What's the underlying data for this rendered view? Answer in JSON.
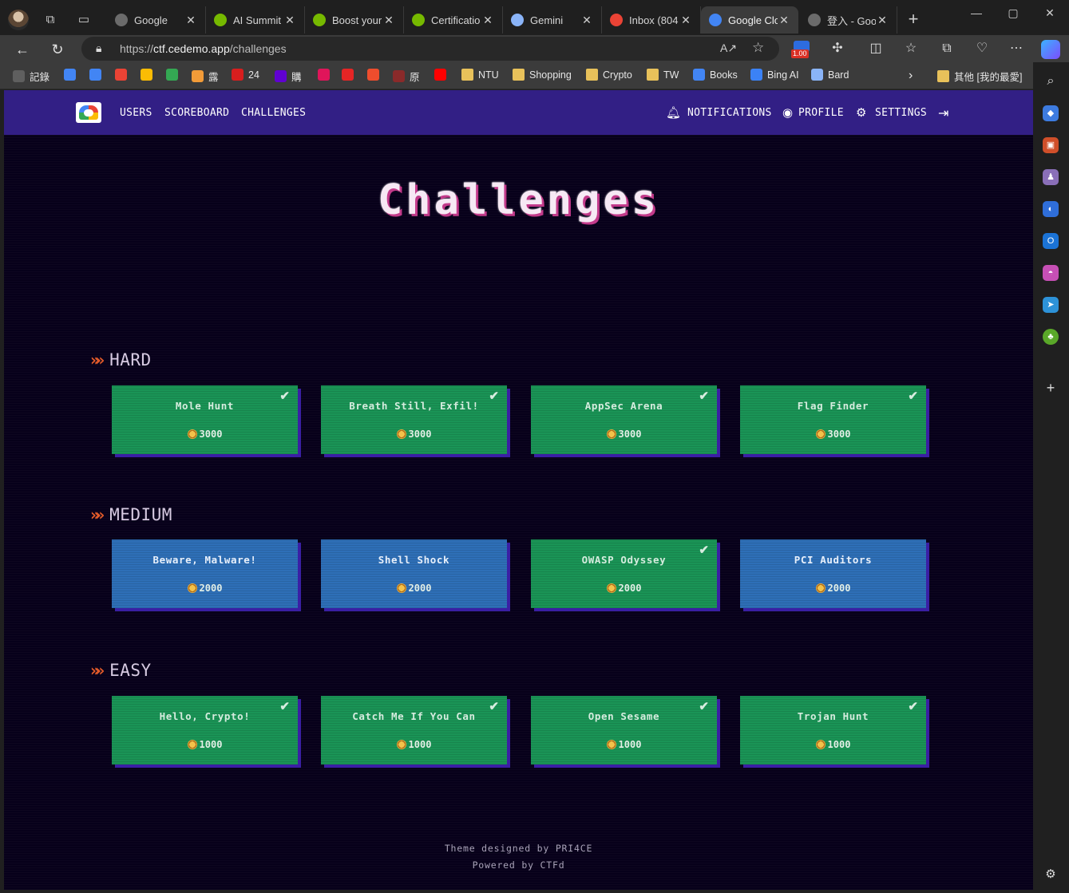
{
  "browser": {
    "tabs": [
      {
        "label": "Google",
        "favicon": "google-icon",
        "color": "#6b6b6b"
      },
      {
        "label": "AI Summit",
        "favicon": "nvidia-icon",
        "color": "#76b900"
      },
      {
        "label": "Boost your",
        "favicon": "nvidia-icon",
        "color": "#76b900"
      },
      {
        "label": "Certificatio",
        "favicon": "nvidia-icon",
        "color": "#76b900"
      },
      {
        "label": "Gemini",
        "favicon": "gemini-icon",
        "color": "#8ab4f8"
      },
      {
        "label": "Inbox (804",
        "favicon": "gmail-icon",
        "color": "#ea4335"
      },
      {
        "label": "Google Clo",
        "favicon": "google-cloud-icon",
        "color": "#4285f4"
      },
      {
        "label": "登入 - Goo",
        "favicon": "google-icon",
        "color": "#6b6b6b"
      }
    ],
    "url": {
      "prefix": "https://",
      "host": "ctf.cedemo.app",
      "path": "/challenges"
    },
    "extension_badge": "1.00",
    "bookmarks": [
      {
        "label": "記錄",
        "icon": "page-icon",
        "color": "#5f5f5f"
      },
      {
        "label": "",
        "icon": "google-icon",
        "color": "#4285f4"
      },
      {
        "label": "",
        "icon": "translate-icon",
        "color": "#4285f4"
      },
      {
        "label": "",
        "icon": "gmail-icon",
        "color": "#ea4335"
      },
      {
        "label": "",
        "icon": "drive-icon",
        "color": "#fbbc04"
      },
      {
        "label": "",
        "icon": "photos-icon",
        "color": "#34a853"
      },
      {
        "label": "露",
        "icon": "lu-icon",
        "color": "#f29b38"
      },
      {
        "label": "24",
        "icon": "24h-icon",
        "color": "#d81e1e"
      },
      {
        "label": "購",
        "icon": "yahoo-icon",
        "color": "#6001d2"
      },
      {
        "label": "",
        "icon": "m-icon",
        "color": "#e0155a"
      },
      {
        "label": "",
        "icon": "c-icon",
        "color": "#e52525"
      },
      {
        "label": "",
        "icon": "shopee-icon",
        "color": "#ee4d2d"
      },
      {
        "label": "原",
        "icon": "yuan-icon",
        "color": "#8a2a2a"
      },
      {
        "label": "",
        "icon": "youtube-icon",
        "color": "#ff0000"
      },
      {
        "label": "NTU",
        "icon": "folder-icon",
        "color": "#e8c15a"
      },
      {
        "label": "Shopping",
        "icon": "folder-icon",
        "color": "#e8c15a"
      },
      {
        "label": "Crypto",
        "icon": "folder-icon",
        "color": "#e8c15a"
      },
      {
        "label": "TW",
        "icon": "folder-icon",
        "color": "#e8c15a"
      },
      {
        "label": "Books",
        "icon": "play-books-icon",
        "color": "#4285f4"
      },
      {
        "label": "Bing AI",
        "icon": "bing-search-icon",
        "color": "#3b82f6"
      },
      {
        "label": "Bard",
        "icon": "bard-icon",
        "color": "#8ab4f8"
      },
      {
        "label": "其他 [我的最愛]",
        "icon": "folder-icon",
        "color": "#e8c15a"
      }
    ]
  },
  "ctf": {
    "nav": {
      "left": [
        "USERS",
        "SCOREBOARD",
        "CHALLENGES"
      ],
      "notifications": "NOTIFICATIONS",
      "profile": "PROFILE",
      "settings": "SETTINGS"
    },
    "title": "Challenges",
    "categories": [
      {
        "name": "HARD",
        "challenges": [
          {
            "name": "Mole Hunt",
            "points": "3000",
            "solved": true
          },
          {
            "name": "Breath Still, Exfil!",
            "points": "3000",
            "solved": true
          },
          {
            "name": "AppSec Arena",
            "points": "3000",
            "solved": true
          },
          {
            "name": "Flag Finder",
            "points": "3000",
            "solved": true
          }
        ]
      },
      {
        "name": "MEDIUM",
        "challenges": [
          {
            "name": "Beware, Malware!",
            "points": "2000",
            "solved": false
          },
          {
            "name": "Shell Shock",
            "points": "2000",
            "solved": false
          },
          {
            "name": "OWASP Odyssey",
            "points": "2000",
            "solved": true
          },
          {
            "name": "PCI Auditors",
            "points": "2000",
            "solved": false
          }
        ]
      },
      {
        "name": "EASY",
        "challenges": [
          {
            "name": "Hello, Crypto!",
            "points": "1000",
            "solved": true
          },
          {
            "name": "Catch Me If You Can",
            "points": "1000",
            "solved": true
          },
          {
            "name": "Open Sesame",
            "points": "1000",
            "solved": true
          },
          {
            "name": "Trojan Hunt",
            "points": "1000",
            "solved": true
          }
        ]
      }
    ],
    "footer": {
      "line1": "Theme designed by PRI4CE",
      "line2": "Powered by CTFd"
    },
    "colors": {
      "nav": "#321f85",
      "solved": "#1a9456",
      "unsolved": "#2e6fb7",
      "background": "#07001a"
    }
  }
}
